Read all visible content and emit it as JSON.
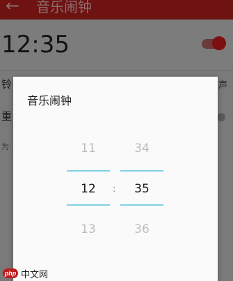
{
  "app_bar": {
    "title": "音乐闹钟",
    "back_icon": "arrow-left-icon"
  },
  "main": {
    "time": "12:35",
    "toggle_on": true,
    "row1_label": "铃",
    "row1_value": "声",
    "row2_label": "重",
    "row3_label": "为"
  },
  "dialog": {
    "title": "音乐闹钟",
    "hour": {
      "prev": "11",
      "current": "12",
      "next": "13"
    },
    "minute": {
      "prev": "34",
      "current": "35",
      "next": "36"
    },
    "separator": ":"
  },
  "watermark": {
    "logo": "php",
    "text": "中文网"
  },
  "colors": {
    "accent": "#8b1a1a",
    "selection_line": "#7fd0e6"
  }
}
